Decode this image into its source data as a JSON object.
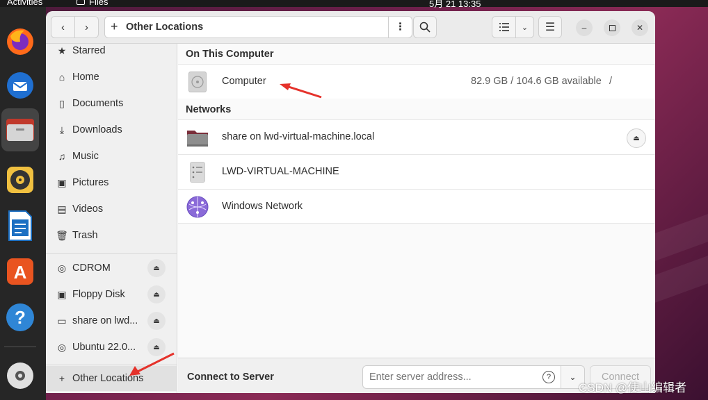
{
  "topbar": {
    "activities": "Activities",
    "app_menu": "Files",
    "clock": "5月 21  13:35"
  },
  "headerbar": {
    "back_icon": "chevron-left-icon",
    "forward_icon": "chevron-right-icon",
    "location": "Other Locations",
    "location_icon": "plus-icon",
    "path_menu_icon": "vertical-dots-icon",
    "search_icon": "search-icon",
    "view_icon": "list-view-icon",
    "view_drop_icon": "chevron-down-icon",
    "menu_icon": "hamburger-icon",
    "window_controls": [
      "minimize-icon",
      "maximize-icon",
      "close-icon"
    ]
  },
  "dock": {
    "items": [
      "firefox-icon",
      "thunderbird-icon",
      "files-icon",
      "rhythmbox-icon",
      "libreoffice-writer-icon",
      "app-center-icon",
      "help-icon",
      "cdrom-icon"
    ]
  },
  "sidebar": {
    "places": [
      {
        "label": "Starred",
        "icon": "star-icon"
      },
      {
        "label": "Home",
        "icon": "home-icon"
      },
      {
        "label": "Documents",
        "icon": "document-icon"
      },
      {
        "label": "Downloads",
        "icon": "download-icon"
      },
      {
        "label": "Music",
        "icon": "music-icon"
      },
      {
        "label": "Pictures",
        "icon": "pictures-icon"
      },
      {
        "label": "Videos",
        "icon": "video-icon"
      },
      {
        "label": "Trash",
        "icon": "trash-icon"
      }
    ],
    "devices": [
      {
        "label": "CDROM",
        "icon": "disc-icon"
      },
      {
        "label": "Floppy Disk",
        "icon": "floppy-icon"
      },
      {
        "label": "share on lwd...",
        "icon": "network-folder-icon"
      },
      {
        "label": "Ubuntu 22.0...",
        "icon": "disc-icon"
      }
    ],
    "other_locations": {
      "label": "Other Locations",
      "icon": "plus-icon"
    }
  },
  "main": {
    "on_this_computer": {
      "heading": "On This Computer",
      "items": [
        {
          "name": "Computer",
          "info": "82.9 GB / 104.6 GB available",
          "path": "/",
          "icon": "drive-harddisk-icon"
        }
      ]
    },
    "networks": {
      "heading": "Networks",
      "items": [
        {
          "name": "share on lwd-virtual-machine.local",
          "icon": "network-folder-icon"
        },
        {
          "name": "LWD-VIRTUAL-MACHINE",
          "icon": "server-icon"
        },
        {
          "name": "Windows Network",
          "icon": "network-globe-icon"
        }
      ]
    }
  },
  "connect": {
    "label": "Connect to Server",
    "placeholder": "Enter server address...",
    "button": "Connect"
  },
  "watermark": "CSDN @使山编辑者",
  "colors": {
    "arrow_red": "#e5322b",
    "selected_bg": "#e1e1e1",
    "desktop_accent": "#6b1f4a"
  }
}
